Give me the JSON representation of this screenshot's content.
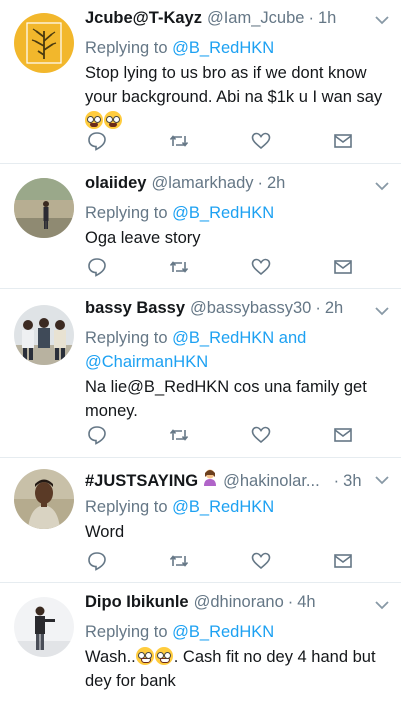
{
  "tweets": [
    {
      "name": "Jcube@T-Kayz",
      "handle": "@Iam_Jcube",
      "time": "1h",
      "replying_prefix": "Replying to ",
      "replying_to": "@B_RedHKN",
      "text": "Stop lying to us bro as if we dont know your background. Abi na $1k u I wan say",
      "emojis": [
        "fearful-face",
        "fearful-face"
      ],
      "avatar_icon": "plant-logo-avatar"
    },
    {
      "name": "olaiidey",
      "handle": "@lamarkhady",
      "time": "2h",
      "replying_prefix": "Replying to ",
      "replying_to": "@B_RedHKN",
      "text": "Oga leave story",
      "avatar_icon": "person-outdoors-avatar"
    },
    {
      "name": "bassy Bassy",
      "handle": "@bassybassy30",
      "time": "2h",
      "replying_prefix": "Replying to ",
      "replying_to": "@B_RedHKN and @ChairmanHKN",
      "text": "Na lie@B_RedHKN cos una family get money.",
      "avatar_icon": "group-photo-avatar"
    },
    {
      "name": "#JUSTSAYING",
      "handle": "@hakinolar...",
      "time": "3h",
      "replying_prefix": "Replying to ",
      "replying_to": "@B_RedHKN",
      "text": "Word",
      "name_emoji": "person-raising-hand",
      "avatar_icon": "man-portrait-avatar"
    },
    {
      "name": "Dipo Ibikunle",
      "handle": "@dhinorano",
      "time": "4h",
      "replying_prefix": "Replying to ",
      "replying_to": "@B_RedHKN",
      "text_before": "Wash..",
      "text_after": ". Cash fit no dey 4 hand but dey for bank",
      "emojis": [
        "grinning-squinting-face",
        "grinning-squinting-face"
      ],
      "avatar_icon": "man-standing-avatar"
    }
  ],
  "actions": [
    "reply-icon",
    "retweet-icon",
    "like-icon",
    "message-icon"
  ],
  "colors": {
    "link": "#1da1f2",
    "secondary_text": "#657786",
    "primary_text": "#14171a",
    "divider": "#e6ecf0"
  }
}
